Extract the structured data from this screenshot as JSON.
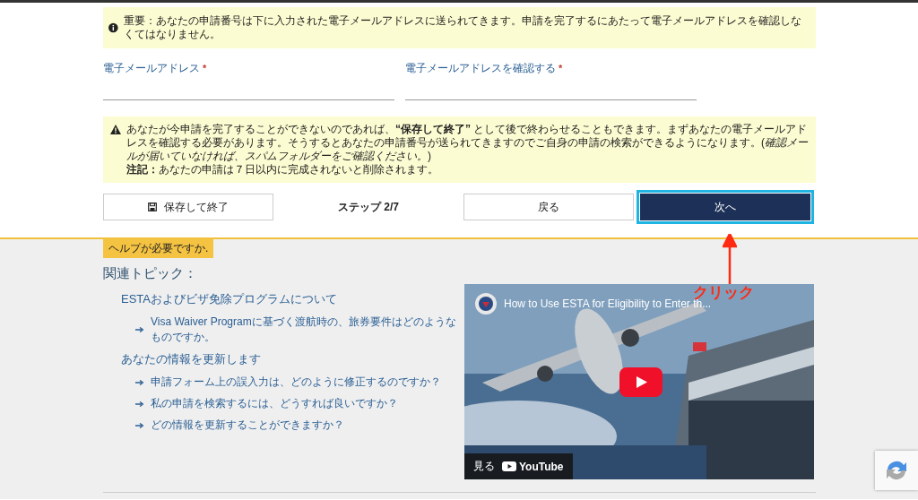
{
  "info_notice": {
    "text": "重要：あなたの申請番号は下に入力された電子メールアドレスに送られてきます。申請を完了するにあたって電子メールアドレスを確認しなくてはなりません。"
  },
  "fields": [
    {
      "label": "電子メールアドレス",
      "required_mark": "*"
    },
    {
      "label": "電子メールアドレスを確認する",
      "required_mark": "*"
    }
  ],
  "warning_notice": {
    "text": "あなたが今申請を完了することができないのであれば、**“保存して終了”** として後で終わらせることもできます。まずあなたの電子メールアドレスを確認する必要があります。そうするとあなたの申請番号が送られてきますのでご自身の申請の検索ができるようになります。(*確認メールが届いていなければ、スパムフォルダーをご確認ください。*)",
    "note": "**注記：**あなたの申請は７日以内に完成されないと削除されます。"
  },
  "actions": {
    "save": "保存して終了",
    "step": "ステップ 2/7",
    "back": "戻る",
    "next": "次へ",
    "next_highlighted": true
  },
  "help": {
    "tag": "ヘルプが必要ですか.",
    "heading": "関連トピック：",
    "groups": [
      {
        "title": "ESTAおよびビザ免除プログラムについて",
        "links": [
          "Visa Waiver Programに基づく渡航時の、旅券要件はどのようなものですか。"
        ]
      },
      {
        "title": "あなたの情報を更新します",
        "links": [
          "申請フォーム上の誤入力は、どのように修正するのですか？",
          "私の申請を検索するには、どうすれば良いですか？",
          "どの情報を更新することができますか？"
        ]
      }
    ]
  },
  "video": {
    "title": "How to Use ESTA for Eligibility to Enter th...",
    "watch": "見る",
    "brand": "YouTube"
  },
  "annotation": {
    "text": "クリック"
  }
}
